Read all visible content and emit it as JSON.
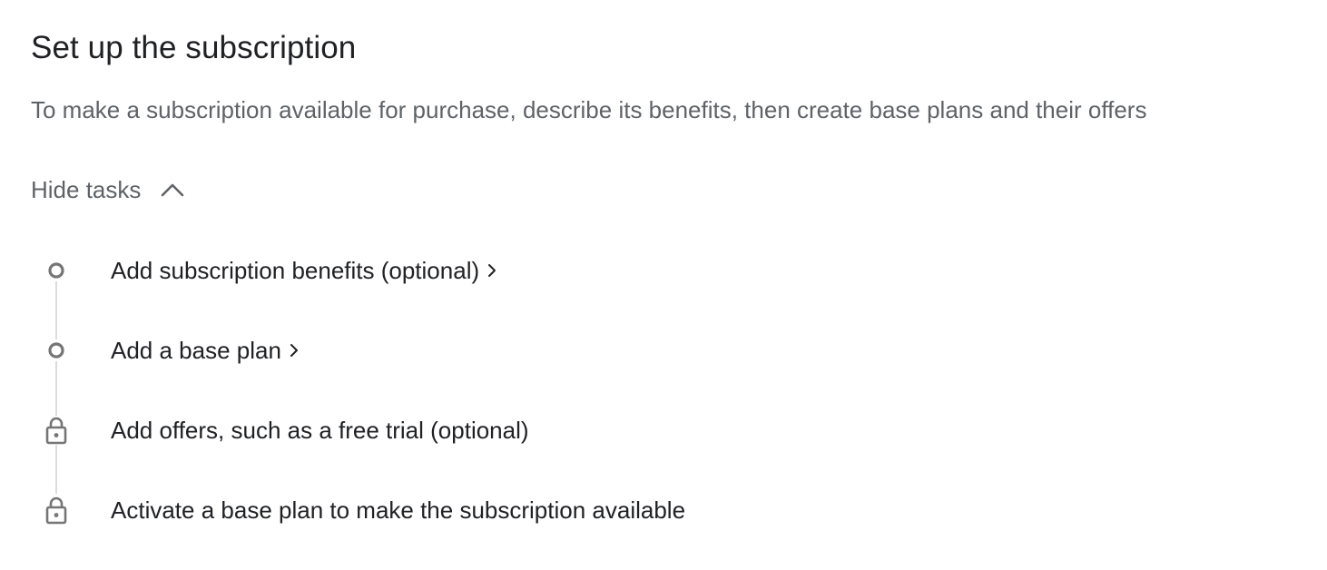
{
  "header": {
    "title": "Set up the subscription",
    "description": "To make a subscription available for purchase, describe its benefits, then create base plans and their offers"
  },
  "toggle": {
    "label": "Hide tasks",
    "icon": "chevron-up-icon"
  },
  "tasks": [
    {
      "label": "Add subscription benefits (optional)",
      "status_icon": "circle-outline-icon",
      "has_arrow": true
    },
    {
      "label": "Add a base plan",
      "status_icon": "circle-outline-icon",
      "has_arrow": true
    },
    {
      "label": "Add offers, such as a free trial (optional)",
      "status_icon": "lock-icon",
      "has_arrow": false
    },
    {
      "label": "Activate a base plan to make the subscription available",
      "status_icon": "lock-icon",
      "has_arrow": false
    }
  ],
  "colors": {
    "text_primary": "#202124",
    "text_secondary": "#5f6368",
    "icon": "#757575",
    "line": "#dadce0"
  }
}
